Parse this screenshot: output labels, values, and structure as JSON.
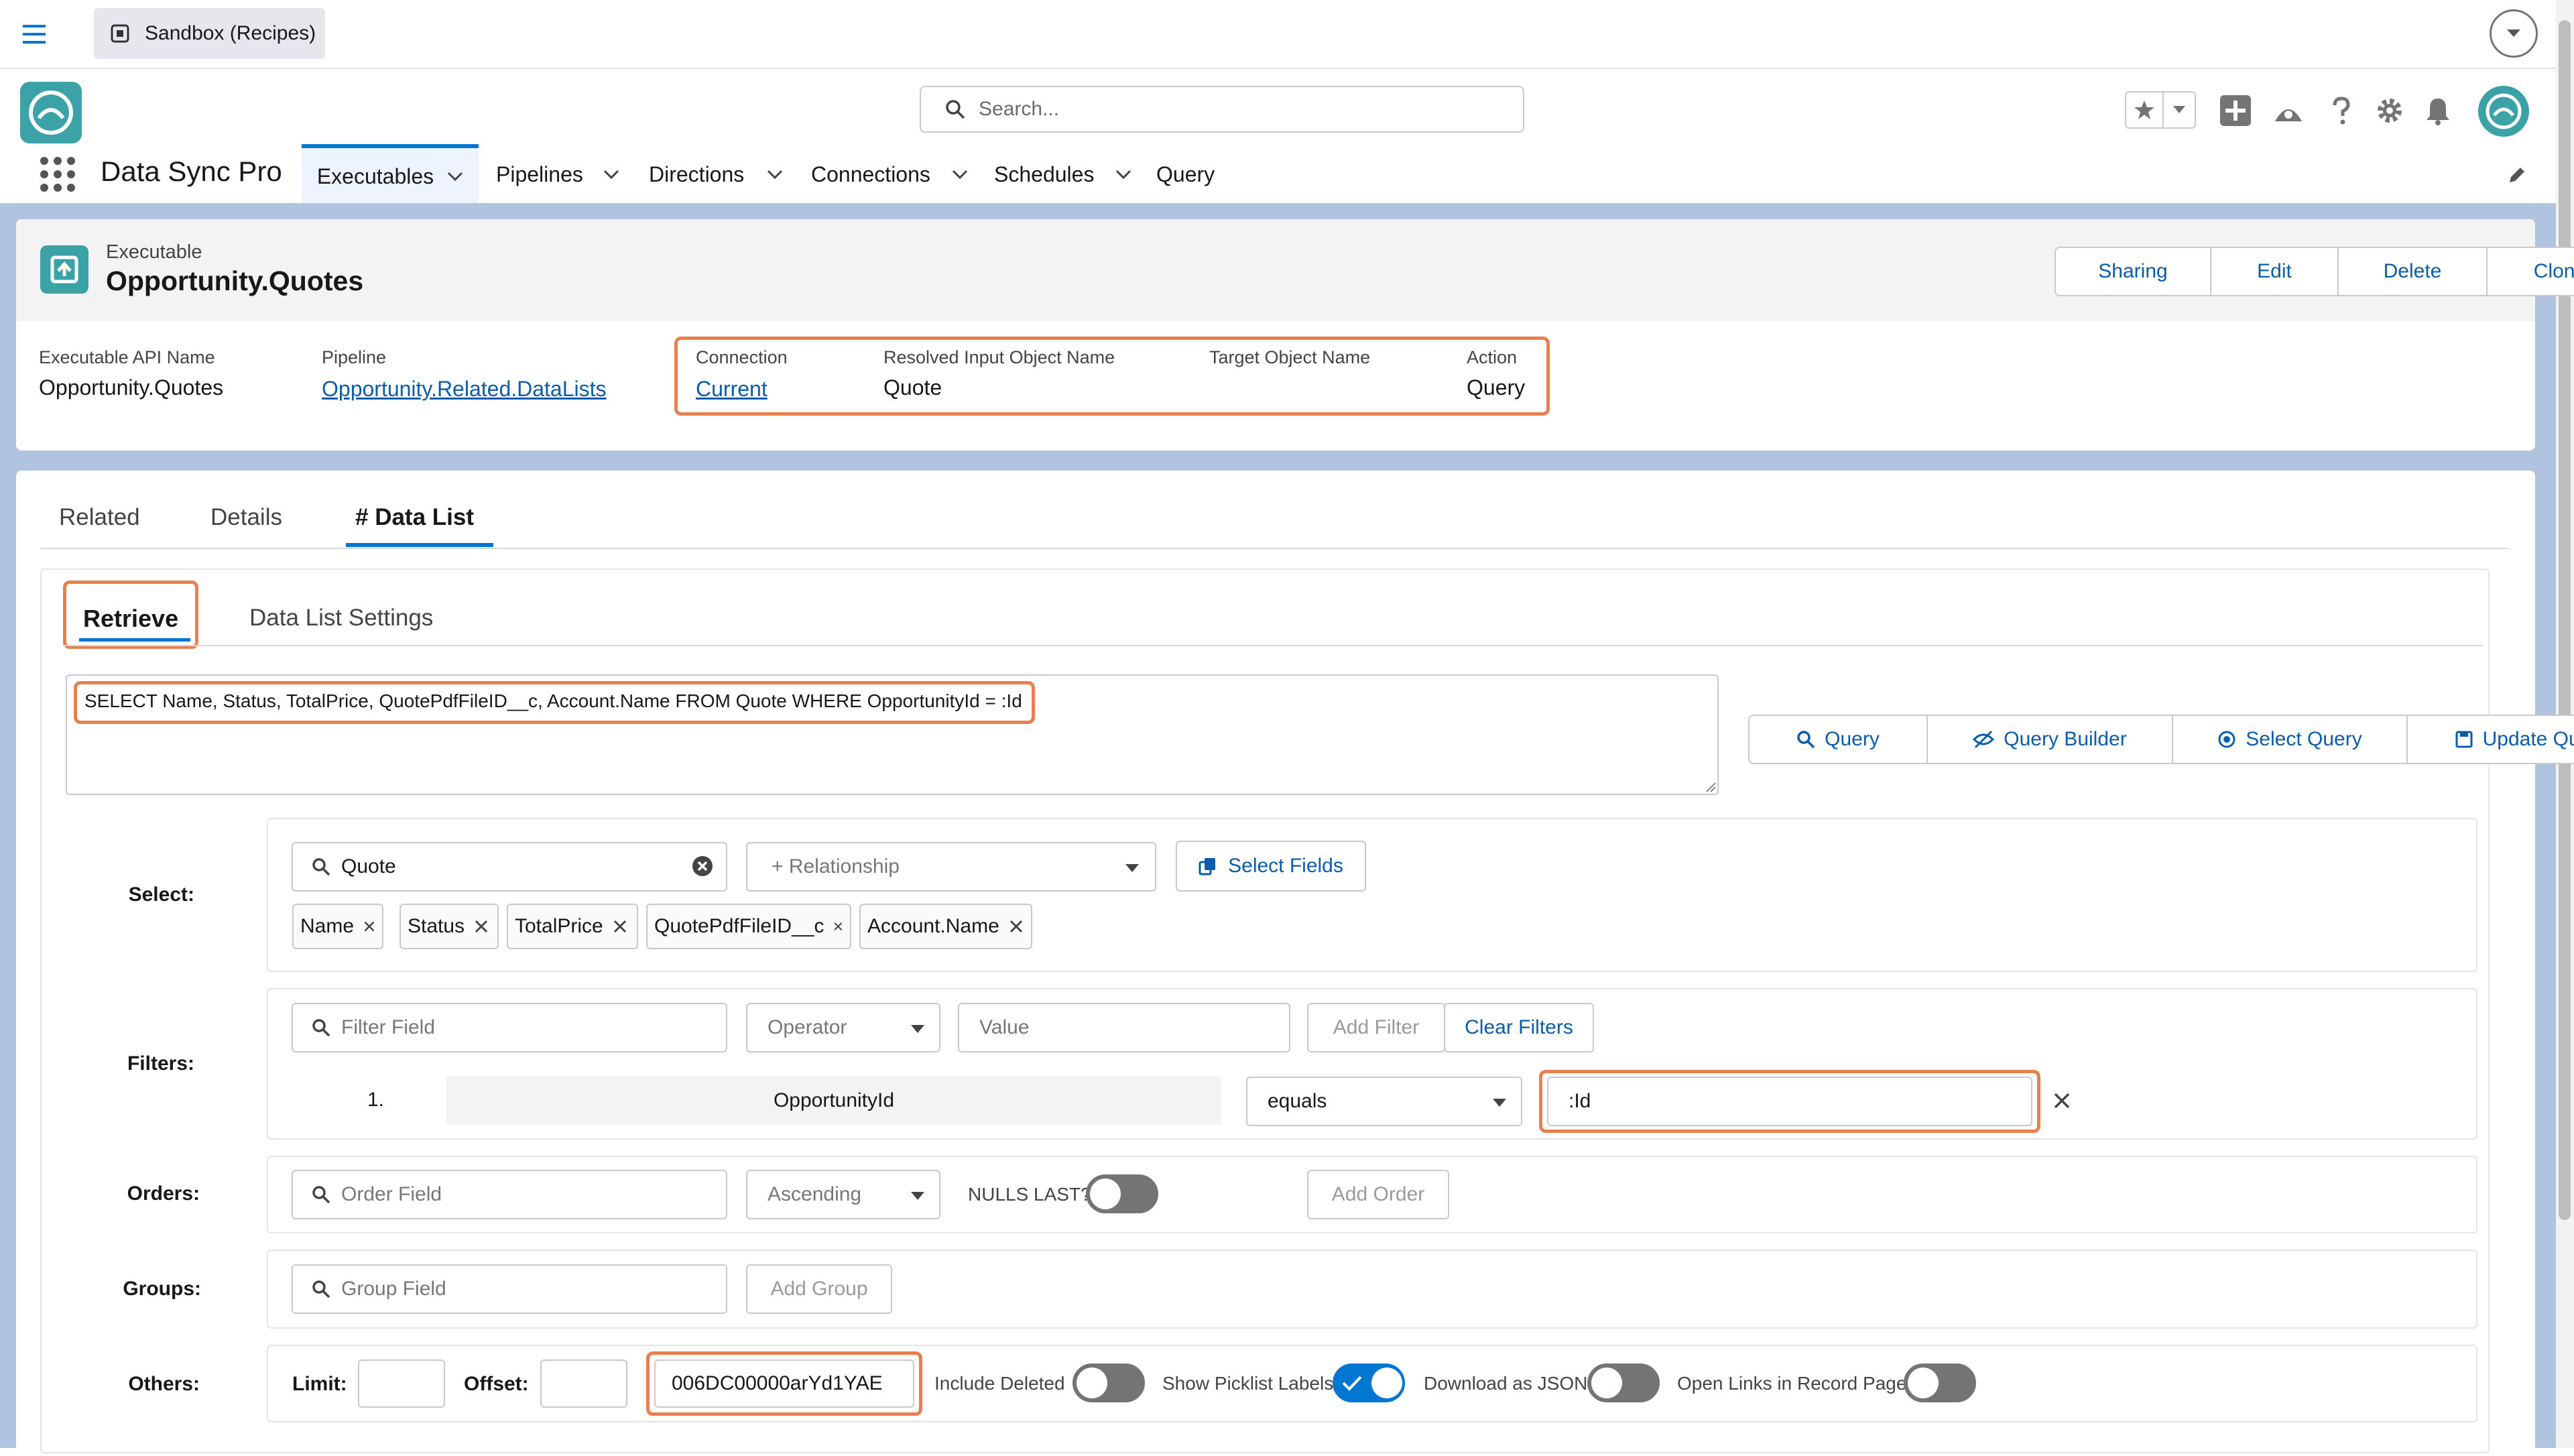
{
  "org_tab": {
    "label": "Sandbox (Recipes)"
  },
  "search": {
    "placeholder": "Search..."
  },
  "app": {
    "name": "Data Sync Pro"
  },
  "nav": [
    {
      "label": "Executables"
    },
    {
      "label": "Pipelines"
    },
    {
      "label": "Directions"
    },
    {
      "label": "Connections"
    },
    {
      "label": "Schedules"
    },
    {
      "label": "Query"
    }
  ],
  "record": {
    "type_label": "Executable",
    "title": "Opportunity.Quotes",
    "actions": [
      "Sharing",
      "Edit",
      "Delete",
      "Clone"
    ],
    "fields": [
      {
        "label": "Executable API Name",
        "value": "Opportunity.Quotes"
      },
      {
        "label": "Pipeline",
        "value": "Opportunity.Related.DataLists"
      },
      {
        "label": "Connection",
        "value": "Current"
      },
      {
        "label": "Resolved Input Object Name",
        "value": "Quote"
      },
      {
        "label": "Target Object Name",
        "value": ""
      },
      {
        "label": "Action",
        "value": "Query"
      }
    ]
  },
  "tabs": [
    "Related",
    "Details",
    "# Data List"
  ],
  "subtabs": [
    "Retrieve",
    "Data List Settings"
  ],
  "query_text": "SELECT Name, Status, TotalPrice, QuotePdfFileID__c, Account.Name FROM Quote WHERE OpportunityId = :Id",
  "query_buttons": [
    "Query",
    "Query Builder",
    "Select Query",
    "Update Query"
  ],
  "select": {
    "label": "Select:",
    "object_value": "Quote",
    "relationship_placeholder": "+ Relationship",
    "select_fields": "Select Fields",
    "chips": [
      "Name",
      "Status",
      "TotalPrice",
      "QuotePdfFileID__c",
      "Account.Name"
    ]
  },
  "filters": {
    "label": "Filters:",
    "field_placeholder": "Filter Field",
    "operator_placeholder": "Operator",
    "value_placeholder": "Value",
    "add": "Add Filter",
    "clear": "Clear Filters",
    "row": {
      "index": "1.",
      "field": "OpportunityId",
      "operator": "equals",
      "value": ":Id"
    }
  },
  "orders": {
    "label": "Orders:",
    "field_placeholder": "Order Field",
    "direction": "Ascending",
    "nulls_last": "NULLS LAST?",
    "add": "Add Order"
  },
  "groups": {
    "label": "Groups:",
    "field_placeholder": "Group Field",
    "add": "Add Group"
  },
  "others": {
    "label": "Others:",
    "limit": "Limit:",
    "offset": "Offset:",
    "record_id": "006DC00000arYd1YAE",
    "include_deleted": "Include Deleted",
    "show_picklist": "Show Picklist Labels",
    "download_json": "Download as JSON",
    "open_links": "Open Links in Record Page"
  },
  "colors": {
    "accent": "#0176d3",
    "highlight": "#e8804e",
    "brand_teal": "#3ba2a8"
  }
}
